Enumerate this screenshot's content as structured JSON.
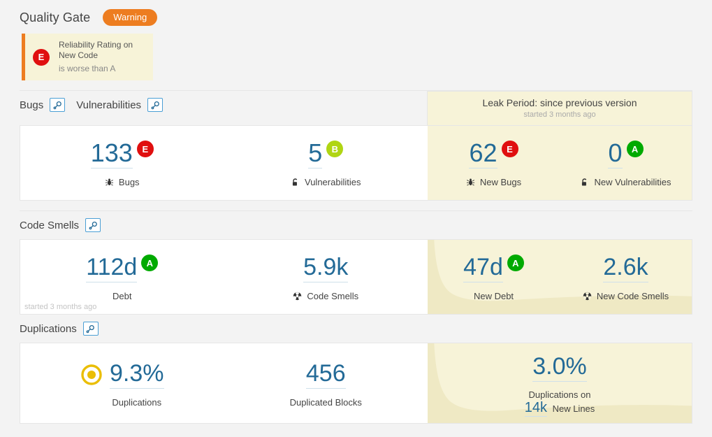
{
  "quality_gate": {
    "title": "Quality Gate",
    "status_label": "Warning",
    "status_color": "#ed7d20",
    "conditions": [
      {
        "rating": "E",
        "rating_color": "#e00f0f",
        "name": "Reliability Rating on New Code",
        "detail": "is worse than A"
      }
    ]
  },
  "leak_period": {
    "title": "Leak Period: since previous version",
    "subtitle": "started 3 months ago"
  },
  "sections": {
    "bugs_vulnerabilities": {
      "label_bugs": "Bugs",
      "label_vulnerabilities": "Vulnerabilities",
      "magnifier_icon": "magnifier-icon",
      "main": [
        {
          "value": "133",
          "rating": "E",
          "rating_color": "#e00f0f",
          "label": "Bugs",
          "icon": "bug-icon"
        },
        {
          "value": "5",
          "rating": "B",
          "rating_color": "#b0d513",
          "label": "Vulnerabilities",
          "icon": "open-lock-icon"
        }
      ],
      "leak": [
        {
          "value": "62",
          "rating": "E",
          "rating_color": "#e00f0f",
          "label": "New Bugs",
          "icon": "bug-icon"
        },
        {
          "value": "0",
          "rating": "A",
          "rating_color": "#00aa00",
          "label": "New Vulnerabilities",
          "icon": "open-lock-icon"
        }
      ]
    },
    "code_smells": {
      "label": "Code Smells",
      "magnifier_icon": "magnifier-icon",
      "started": "started 3 months ago",
      "main": [
        {
          "value": "112d",
          "rating": "A",
          "rating_color": "#00aa00",
          "label": "Debt",
          "icon": null
        },
        {
          "value": "5.9k",
          "rating": null,
          "rating_color": null,
          "label": "Code Smells",
          "icon": "code-smell-icon"
        }
      ],
      "leak": [
        {
          "value": "47d",
          "rating": "A",
          "rating_color": "#00aa00",
          "label": "New Debt",
          "icon": null
        },
        {
          "value": "2.6k",
          "rating": null,
          "rating_color": null,
          "label": "New Code Smells",
          "icon": "code-smell-icon"
        }
      ]
    },
    "duplications": {
      "label": "Duplications",
      "magnifier_icon": "magnifier-icon",
      "main": [
        {
          "value": "9.3%",
          "label": "Duplications",
          "icon": "duplication-donut-icon",
          "icon_color": "#eabe06"
        },
        {
          "value": "456",
          "label": "Duplicated Blocks",
          "icon": null
        }
      ],
      "leak": {
        "value": "3.0%",
        "label_line1": "Duplications on",
        "inline_value": "14k",
        "label_line2": "New Lines"
      }
    }
  }
}
